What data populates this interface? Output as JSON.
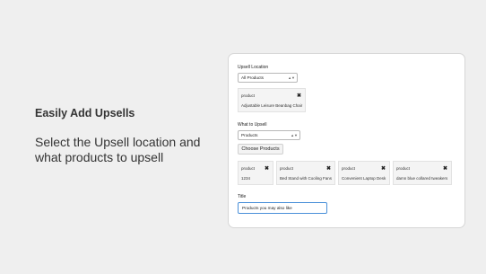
{
  "promo": {
    "headline": "Easily Add Upsells",
    "description": "Select the Upsell location and what products to upsell"
  },
  "form": {
    "location_label": "Upsell Location",
    "location_value": "All Products",
    "location_chip": {
      "type": "product",
      "name": "Adjustable Leisure Beanbag Chair"
    },
    "what_label": "What to Upsell",
    "what_value": "Products",
    "choose_button": "Choose Products",
    "product_chips": [
      {
        "type": "product",
        "name": "1234"
      },
      {
        "type": "product",
        "name": "Bed Stand with Cooling Fans"
      },
      {
        "type": "product",
        "name": "Convenient Laptop Desk"
      },
      {
        "type": "product",
        "name": "damn blue collared tweakers"
      }
    ],
    "title_label": "Title",
    "title_value": "Products you may also like"
  },
  "icons": {
    "close": "close-icon",
    "dropdown": "chevron-down-icon"
  }
}
